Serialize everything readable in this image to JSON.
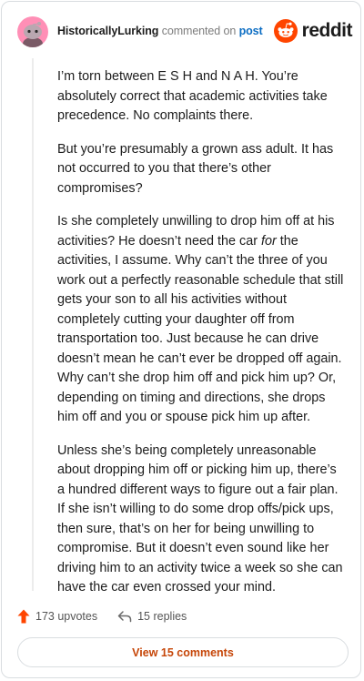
{
  "header": {
    "username": "HistoricallyLurking",
    "action_text": "commented on",
    "target_text": "post",
    "logo_text": "reddit"
  },
  "colors": {
    "reddit_orange": "#ff4500",
    "link_blue": "#0b6dc3",
    "button_text": "#c64608",
    "avatar_bg": "#ff8fb6"
  },
  "comment": {
    "paragraphs": [
      "I’m torn between E S H and N A H. You’re absolutely correct that academic activities take precedence. No complaints there.",
      "But you’re presumably a grown ass adult. It has not occurred to you that there’s other compromises?",
      "Unless she’s being completely unreasonable about dropping him off or picking him up, there’s a hundred different ways to figure out a fair plan. If she isn’t willing to do some drop offs/pick ups, then sure, that’s on her for being unwilling to compromise. But it doesn’t even sound like her driving him to an activity twice a week so she can have the car even crossed your mind."
    ],
    "para3": {
      "before": "Is she completely unwilling to drop him off at his activities? He doesn’t need the car ",
      "emphasis": "for",
      "after": " the activities, I assume. Why can’t the three of you work out a perfectly reasonable schedule that still gets your son to all his activities without completely cutting your daughter off from transportation too. Just because he can drive doesn’t mean he can’t ever be dropped off again. Why can’t she drop him off and pick him up? Or, depending on timing and directions, she drops him off and you or spouse pick him up after."
    }
  },
  "footer": {
    "upvotes_label": "173 upvotes",
    "replies_label": "15 replies",
    "view_button_label": "View 15 comments"
  },
  "icons": {
    "avatar": "snoo-avatar-icon",
    "logo": "reddit-snoo-icon",
    "upvote": "upvote-arrow-icon",
    "reply": "reply-arrow-icon"
  }
}
